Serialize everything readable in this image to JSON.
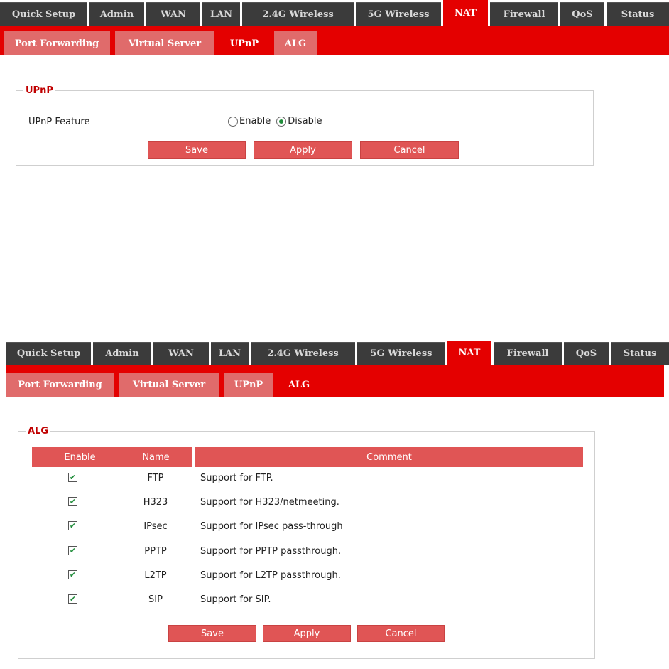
{
  "nav": {
    "tabs": [
      "Quick Setup",
      "Admin",
      "WAN",
      "LAN",
      "2.4G Wireless",
      "5G Wireless",
      "NAT",
      "Firewall",
      "QoS",
      "Status"
    ],
    "active": "NAT"
  },
  "subnav": {
    "tabs": [
      "Port Forwarding",
      "Virtual Server",
      "UPnP",
      "ALG"
    ]
  },
  "upnp": {
    "legend": "UPnP",
    "feature_label": "UPnP Feature",
    "enable_label": "Enable",
    "disable_label": "Disable",
    "selected": "Disable",
    "save": "Save",
    "apply": "Apply",
    "cancel": "Cancel"
  },
  "alg": {
    "legend": "ALG",
    "headers": {
      "enable": "Enable",
      "name": "Name",
      "comment": "Comment"
    },
    "rows": [
      {
        "name": "FTP",
        "comment": "Support for FTP.",
        "enabled": true
      },
      {
        "name": "H323",
        "comment": "Support for H323/netmeeting.",
        "enabled": true
      },
      {
        "name": "IPsec",
        "comment": "Support for IPsec pass-through",
        "enabled": true
      },
      {
        "name": "PPTP",
        "comment": "Support for PPTP passthrough.",
        "enabled": true
      },
      {
        "name": "L2TP",
        "comment": "Support for L2TP passthrough.",
        "enabled": true
      },
      {
        "name": "SIP",
        "comment": "Support for SIP.",
        "enabled": true
      }
    ],
    "save": "Save",
    "apply": "Apply",
    "cancel": "Cancel"
  },
  "colors": {
    "accent_red": "#e40000",
    "button_red": "#e05555",
    "nav_dark": "#3b3b3b",
    "check_green": "#1f8c3a"
  }
}
